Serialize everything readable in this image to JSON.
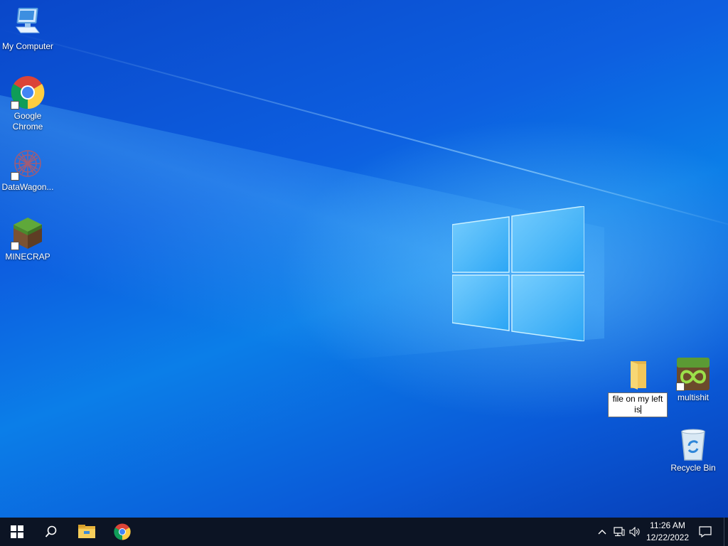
{
  "desktop": {
    "icons_left": [
      {
        "label": "My Computer",
        "icon": "computer-icon"
      },
      {
        "label": "Google Chrome",
        "icon": "chrome-icon"
      },
      {
        "label": "DataWagon...",
        "icon": "datawagon-icon"
      },
      {
        "label": "MINECRAP",
        "icon": "minecraft-icon"
      }
    ],
    "icons_right": [
      {
        "label": "multishit",
        "icon": "multimc-icon"
      },
      {
        "label": "Recycle Bin",
        "icon": "recycle-bin-icon"
      }
    ],
    "renaming_folder": {
      "icon": "folder-icon",
      "edit_text_line1": "file on my left",
      "edit_text_line2": "is"
    }
  },
  "taskbar": {
    "start": "windows-start-icon",
    "search": "search-icon",
    "pinned": [
      "file-explorer-icon",
      "chrome-icon"
    ],
    "tray": {
      "icons": [
        "chevron-up-icon",
        "network-icon",
        "volume-icon"
      ],
      "time": "11:26 AM",
      "date": "12/22/2022",
      "notifications": "action-center-icon"
    }
  },
  "colors": {
    "desktop_blue": "#0b6ee6",
    "taskbar": "#0c1424"
  }
}
